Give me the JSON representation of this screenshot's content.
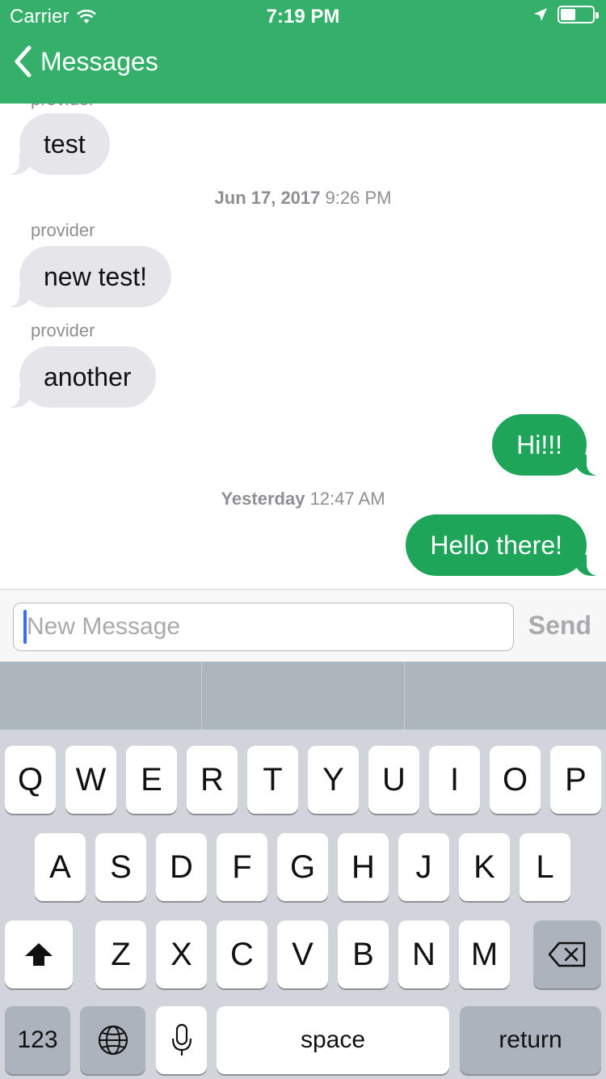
{
  "status_bar": {
    "carrier": "Carrier",
    "time": "7:19 PM"
  },
  "nav": {
    "back_label": "Messages"
  },
  "colors": {
    "header": "#34b06a",
    "outgoing_bubble": "#1fa55a",
    "incoming_bubble": "#e5e5ea"
  },
  "messages": [
    {
      "sender": "provider",
      "text": "test"
    },
    {
      "timestamp_day": "Jun 17, 2017",
      "timestamp_time": "9:26 PM"
    },
    {
      "sender": "provider",
      "text": "new test!"
    },
    {
      "sender": "provider",
      "text": "another"
    },
    {
      "text": "Hi!!!"
    },
    {
      "timestamp_day": "Yesterday",
      "timestamp_time": "12:47 AM"
    },
    {
      "text": "Hello there!"
    }
  ],
  "composer": {
    "placeholder": "New Message",
    "send_label": "Send"
  },
  "keyboard": {
    "row1": [
      "Q",
      "W",
      "E",
      "R",
      "T",
      "Y",
      "U",
      "I",
      "O",
      "P"
    ],
    "row2": [
      "A",
      "S",
      "D",
      "F",
      "G",
      "H",
      "J",
      "K",
      "L"
    ],
    "row3": [
      "Z",
      "X",
      "C",
      "V",
      "B",
      "N",
      "M"
    ],
    "numbers_label": "123",
    "space_label": "space",
    "return_label": "return",
    "shift_icon": "shift-arrow-icon",
    "delete_icon": "backspace-icon",
    "globe_icon": "globe-icon",
    "mic_icon": "microphone-icon"
  }
}
